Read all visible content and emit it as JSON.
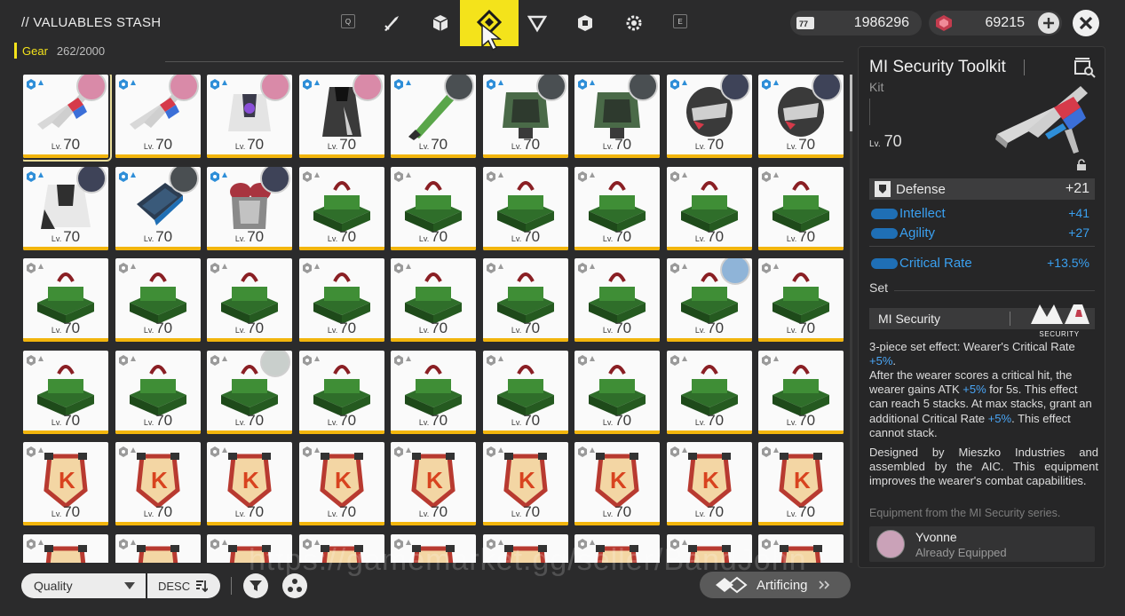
{
  "header": {
    "title": "// VALUABLES STASH",
    "key_left": "Q",
    "key_right": "E",
    "tabs": [
      {
        "name": "tab-weapons",
        "icon": "blade-icon"
      },
      {
        "name": "tab-cube",
        "icon": "cube-icon"
      },
      {
        "name": "tab-gear",
        "icon": "gear-diamond-icon",
        "active": true
      },
      {
        "name": "tab-triangle",
        "icon": "triangle-icon"
      },
      {
        "name": "tab-materials",
        "icon": "hexagon-box-icon"
      },
      {
        "name": "tab-misc",
        "icon": "cog-icon"
      }
    ],
    "currency1": {
      "value": "1986296",
      "icon": "t-creds-icon"
    },
    "currency2": {
      "value": "69215",
      "icon": "origeometry-icon"
    }
  },
  "gear": {
    "label": "Gear",
    "count": "262/2000"
  },
  "grid": {
    "items": [
      {
        "kind": "toolkit",
        "lv": "70",
        "av": "pink"
      },
      {
        "kind": "toolkit",
        "lv": "70",
        "av": "pink"
      },
      {
        "kind": "armor",
        "lv": "70",
        "av": "pink"
      },
      {
        "kind": "cloak",
        "lv": "70",
        "av": "pink"
      },
      {
        "kind": "green-tube",
        "lv": "70",
        "av": "dark"
      },
      {
        "kind": "green-armor",
        "lv": "70",
        "av": "dark"
      },
      {
        "kind": "green-armor",
        "lv": "70",
        "av": "dark"
      },
      {
        "kind": "helmet",
        "lv": "70",
        "av": "navy"
      },
      {
        "kind": "helmet",
        "lv": "70",
        "av": "navy"
      },
      {
        "kind": "white-armor",
        "lv": "70",
        "av": "navy"
      },
      {
        "kind": "blue-pad",
        "lv": "70",
        "av": "dark"
      },
      {
        "kind": "red-armor",
        "lv": "70",
        "av": "navy"
      },
      {
        "kind": "green-box",
        "lv": "70"
      },
      {
        "kind": "green-box",
        "lv": "70"
      },
      {
        "kind": "green-box",
        "lv": "70"
      },
      {
        "kind": "green-box",
        "lv": "70"
      },
      {
        "kind": "green-box",
        "lv": "70"
      },
      {
        "kind": "green-box",
        "lv": "70"
      },
      {
        "kind": "green-box",
        "lv": "70"
      },
      {
        "kind": "green-box",
        "lv": "70"
      },
      {
        "kind": "green-box",
        "lv": "70"
      },
      {
        "kind": "green-box",
        "lv": "70"
      },
      {
        "kind": "green-box",
        "lv": "70"
      },
      {
        "kind": "green-box",
        "lv": "70"
      },
      {
        "kind": "green-box",
        "lv": "70"
      },
      {
        "kind": "green-box",
        "lv": "70",
        "av": "blue"
      },
      {
        "kind": "green-box",
        "lv": "70"
      },
      {
        "kind": "green-box",
        "lv": "70"
      },
      {
        "kind": "green-box",
        "lv": "70"
      },
      {
        "kind": "green-box",
        "lv": "70",
        "av": "grey"
      },
      {
        "kind": "green-box",
        "lv": "70"
      },
      {
        "kind": "green-box",
        "lv": "70"
      },
      {
        "kind": "green-box",
        "lv": "70"
      },
      {
        "kind": "green-box",
        "lv": "70"
      },
      {
        "kind": "green-box",
        "lv": "70"
      },
      {
        "kind": "green-box",
        "lv": "70"
      },
      {
        "kind": "k-tag",
        "lv": "70"
      },
      {
        "kind": "k-tag",
        "lv": "70"
      },
      {
        "kind": "k-tag",
        "lv": "70"
      },
      {
        "kind": "k-tag",
        "lv": "70"
      },
      {
        "kind": "k-tag",
        "lv": "70"
      },
      {
        "kind": "k-tag",
        "lv": "70"
      },
      {
        "kind": "k-tag",
        "lv": "70"
      },
      {
        "kind": "k-tag",
        "lv": "70"
      },
      {
        "kind": "k-tag",
        "lv": "70"
      },
      {
        "kind": "k-tag",
        "lv": ""
      },
      {
        "kind": "k-tag",
        "lv": ""
      },
      {
        "kind": "k-tag",
        "lv": ""
      },
      {
        "kind": "k-tag",
        "lv": ""
      },
      {
        "kind": "k-tag",
        "lv": ""
      },
      {
        "kind": "k-tag",
        "lv": ""
      },
      {
        "kind": "k-tag",
        "lv": ""
      },
      {
        "kind": "k-tag",
        "lv": ""
      },
      {
        "kind": "k-tag",
        "lv": ""
      }
    ],
    "lv_prefix": "Lv."
  },
  "detail": {
    "name": "MI Security Toolkit",
    "type": "Kit",
    "lv_prefix": "Lv.",
    "level": "70",
    "main_stat": {
      "name": "Defense",
      "value": "+21"
    },
    "stats": [
      {
        "name": "Intellect",
        "value": "+41"
      },
      {
        "name": "Agility",
        "value": "+27"
      },
      {
        "name": "Critical Rate",
        "value": "+13.5%"
      }
    ],
    "set_label": "Set",
    "set_name": "MI Security",
    "set_logo_text": "SECURITY",
    "desc1_a": "3-piece set effect: Wearer's Critical Rate ",
    "desc1_hi": "+5%",
    "desc1_b": ".",
    "desc2_a": "After the wearer scores a critical hit, the wearer gains ATK ",
    "desc2_hi1": "+5%",
    "desc2_b": " for 5s. This effect can reach 5 stacks. At max stacks, grant an additional Critical Rate ",
    "desc2_hi2": "+5%",
    "desc2_c": ". This effect cannot stack.",
    "desc3": "Designed by Mieszko Industries and assembled by the AIC. This equipment improves the wearer's combat capabilities.",
    "desc4": "Equipment from the MI Security series.",
    "equipped_by": "Yvonne",
    "equipped_status": "Already Equipped"
  },
  "bottom": {
    "sort_value": "Quality",
    "order_value": "DESC",
    "artificing_label": "Artificing"
  },
  "watermark": "https://gamemarket.gg/seller/BandJohn",
  "colors": {
    "accent": "#f4e31b",
    "stat_blue": "#3aa0f0",
    "rarity": "#f2b50c"
  }
}
